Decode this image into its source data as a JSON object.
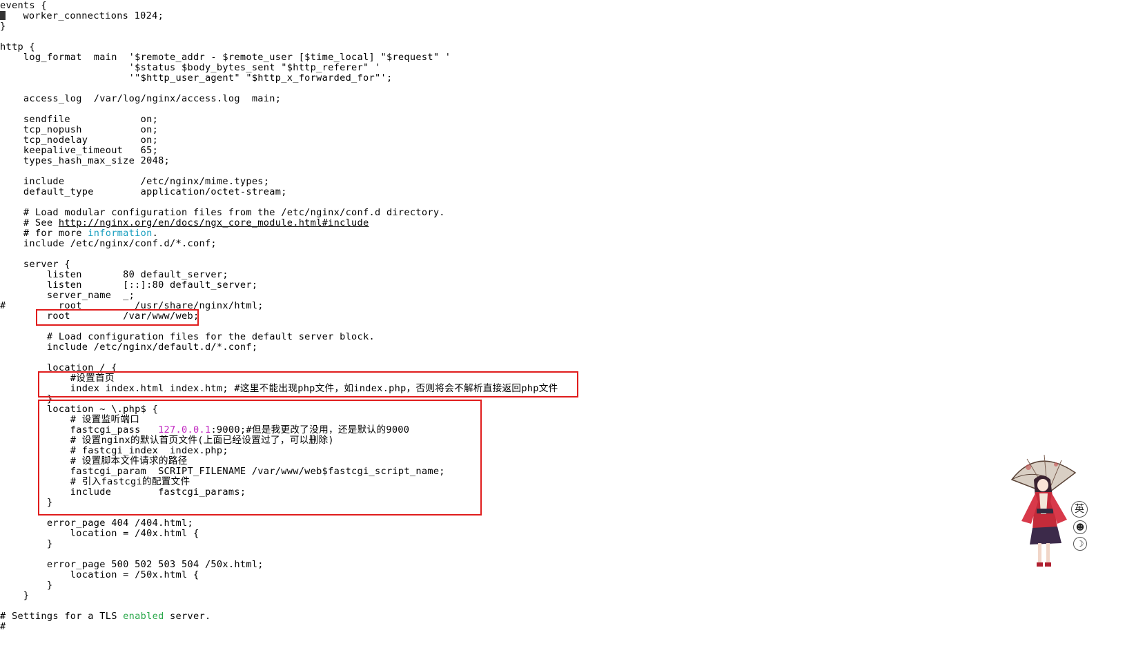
{
  "terminal": {
    "lines": [
      [
        {
          "t": "events {"
        }
      ],
      [
        {
          "cursor": true
        },
        {
          "t": "   worker_connections 1024;"
        }
      ],
      [
        {
          "t": "}"
        }
      ],
      [],
      [
        {
          "t": "http {"
        }
      ],
      [
        {
          "t": "    log_format  main  '$remote_addr - $remote_user [$time_local] \"$request\" '"
        }
      ],
      [
        {
          "t": "                      '$status $body_bytes_sent \"$http_referer\" '"
        }
      ],
      [
        {
          "t": "                      '\"$http_user_agent\" \"$http_x_forwarded_for\"';"
        }
      ],
      [],
      [
        {
          "t": "    access_log  /var/log/nginx/access.log  main;"
        }
      ],
      [],
      [
        {
          "t": "    sendfile            on;"
        }
      ],
      [
        {
          "t": "    tcp_nopush          on;"
        }
      ],
      [
        {
          "t": "    tcp_nodelay         on;"
        }
      ],
      [
        {
          "t": "    keepalive_timeout   65;"
        }
      ],
      [
        {
          "t": "    types_hash_max_size 2048;"
        }
      ],
      [],
      [
        {
          "t": "    include             /etc/nginx/mime.types;"
        }
      ],
      [
        {
          "t": "    default_type        application/octet-stream;"
        }
      ],
      [],
      [
        {
          "t": "    # Load modular configuration files from the /etc/nginx/conf.d directory."
        }
      ],
      [
        {
          "t": "    # See "
        },
        {
          "t": "http://nginx.org/en/docs/ngx_core_module.html#include",
          "c": "url"
        }
      ],
      [
        {
          "t": "    # for more "
        },
        {
          "t": "information",
          "c": "cyan"
        },
        {
          "t": "."
        }
      ],
      [
        {
          "t": "    include /etc/nginx/conf.d/*.conf;"
        }
      ],
      [],
      [
        {
          "t": "    server {"
        }
      ],
      [
        {
          "t": "        listen       80 default_server;"
        }
      ],
      [
        {
          "t": "        listen       [::]:80 default_server;"
        }
      ],
      [
        {
          "t": "        server_name  _;"
        }
      ],
      [
        {
          "t": "#         root         /usr/share/nginx/html;"
        }
      ],
      [
        {
          "t": "        root         /var/www/web;"
        }
      ],
      [],
      [
        {
          "t": "        # Load configuration files for the default server block."
        }
      ],
      [
        {
          "t": "        include /etc/nginx/default.d/*.conf;"
        }
      ],
      [],
      [
        {
          "t": "        location / {"
        }
      ],
      [
        {
          "t": "            #设置首页"
        }
      ],
      [
        {
          "t": "            index index.html index.htm; #这里不能出现php文件，如index.php，否则将会不解析直接返回php文件"
        }
      ],
      [
        {
          "t": "        }"
        }
      ],
      [
        {
          "t": "        location ~ \\.php$ {"
        }
      ],
      [
        {
          "t": "            # 设置监听端口"
        }
      ],
      [
        {
          "t": "            fastcgi_pass   "
        },
        {
          "t": "127.0.0.1",
          "c": "magenta"
        },
        {
          "t": ":9000;#但是我更改了没用，还是默认的9000"
        }
      ],
      [
        {
          "t": "            # 设置nginx的默认首页文件(上面已经设置过了，可以删除)"
        }
      ],
      [
        {
          "t": "            # fastcgi_index  index.php;"
        }
      ],
      [
        {
          "t": "            # 设置脚本文件请求的路径"
        }
      ],
      [
        {
          "t": "            fastcgi_param  SCRIPT_FILENAME /var/www/web$fastcgi_script_name;"
        }
      ],
      [
        {
          "t": "            # 引入fastcgi的配置文件"
        }
      ],
      [
        {
          "t": "            include        fastcgi_params;"
        }
      ],
      [
        {
          "t": "        }"
        }
      ],
      [],
      [
        {
          "t": "        error_page 404 /404.html;"
        }
      ],
      [
        {
          "t": "            location = /40x.html {"
        }
      ],
      [
        {
          "t": "        }"
        }
      ],
      [],
      [
        {
          "t": "        error_page 500 502 503 504 /50x.html;"
        }
      ],
      [
        {
          "t": "            location = /50x.html {"
        }
      ],
      [
        {
          "t": "        }"
        }
      ],
      [
        {
          "t": "    }"
        }
      ],
      [],
      [
        {
          "t": "# Settings for a TLS "
        },
        {
          "t": "enabled",
          "c": "green"
        },
        {
          "t": " server."
        }
      ],
      [
        {
          "t": "#"
        }
      ]
    ]
  },
  "colors": {
    "highlight_box": "#e01c1c",
    "url": "#000000",
    "cyan_keyword": "#1a9fbf",
    "ip_literal": "#c026c0",
    "green_keyword": "#2aa84a"
  },
  "widget": {
    "mascot": "anime-girl-with-umbrella",
    "buttons": [
      {
        "label": "英",
        "name": "input-method-button"
      },
      {
        "label": "☻",
        "name": "emoji-button"
      },
      {
        "label": "☽",
        "name": "moon-icon-button"
      }
    ]
  }
}
